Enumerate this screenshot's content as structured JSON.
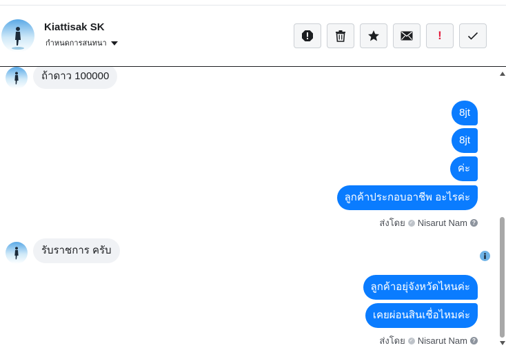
{
  "header": {
    "name": "Kiattisak SK",
    "conversation_settings_label": "กำหนดการสนทนา"
  },
  "actions": [
    {
      "icon": "report-icon",
      "label": ""
    },
    {
      "icon": "trash-icon",
      "label": ""
    },
    {
      "icon": "star-icon",
      "label": ""
    },
    {
      "icon": "envelope-icon",
      "label": ""
    },
    {
      "icon": "exclamation-icon",
      "label": "!"
    },
    {
      "icon": "checkmark-icon",
      "label": ""
    }
  ],
  "messages": {
    "incoming_1": "ถ้าดาว 100000",
    "outgoing_1": "8jt",
    "outgoing_2": "8jt",
    "outgoing_3": "ค่ะ",
    "outgoing_4": "ลูกค้าประกอบอาชีพ อะไรค่ะ",
    "sent_by_1": "ส่งโดย",
    "sender_1": "Nisarut Nam",
    "incoming_2": "รับราชการ ครับ",
    "outgoing_5": "ลูกค้าอยุ่จังหวัดไหนค่ะ",
    "outgoing_6": "เคยผ่อนสินเชื่อไหมค่ะ",
    "sent_by_2": "ส่งโดย",
    "sender_2": "Nisarut Nam"
  },
  "colors": {
    "outgoing_bubble": "#0a7cff",
    "incoming_bubble": "#f0f2f5",
    "alert_red": "#e41e3f"
  }
}
